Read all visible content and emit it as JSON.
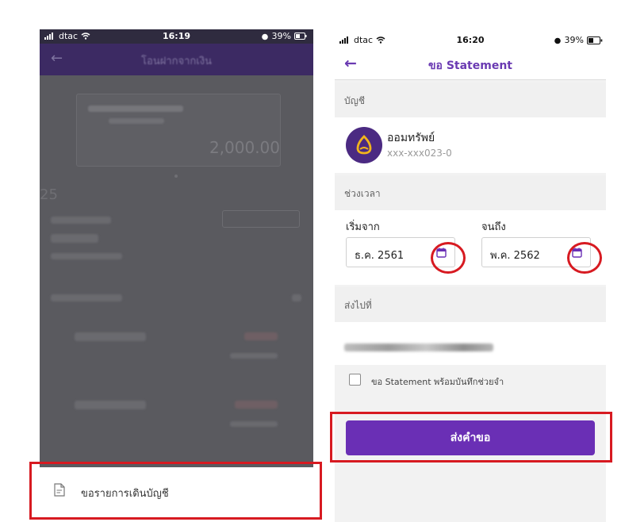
{
  "left_screen": {
    "status_bar": {
      "carrier": "dtac",
      "time": "16:19",
      "battery": "39%"
    },
    "header": {
      "title": "โอนฝากจากเงิน"
    },
    "account_card": {
      "amount": "2,000.00",
      "side_value": "25"
    },
    "action_sheet": {
      "label": "ขอรายการเดินบัญชี"
    }
  },
  "right_screen": {
    "status_bar": {
      "carrier": "dtac",
      "time": "16:20",
      "battery": "39%"
    },
    "header": {
      "title": "ขอ Statement"
    },
    "account_section": {
      "label": "บัญชี",
      "bank_name": "ออมทรัพย์",
      "account_number": "xxx-xxx023-0"
    },
    "period_section": {
      "label": "ช่วงเวลา",
      "from_label": "เริ่มจาก",
      "from_value": "ธ.ค. 2561",
      "to_label": "จนถึง",
      "to_value": "พ.ค. 2562"
    },
    "send_section": {
      "label": "ส่งไปที่"
    },
    "checkbox_label": "ขอ Statement พร้อมบันทึกช่วยจำ",
    "submit_label": "ส่งคำขอ"
  },
  "colors": {
    "brand_purple": "#6a2fb5",
    "highlight_red": "#d71a21",
    "overlay_gray": "#5a5a5f"
  },
  "icons": [
    "wifi-icon",
    "signal-icon",
    "alarm-icon",
    "battery-icon",
    "back-arrow-icon",
    "calendar-icon",
    "document-icon",
    "bank-logo-icon"
  ]
}
